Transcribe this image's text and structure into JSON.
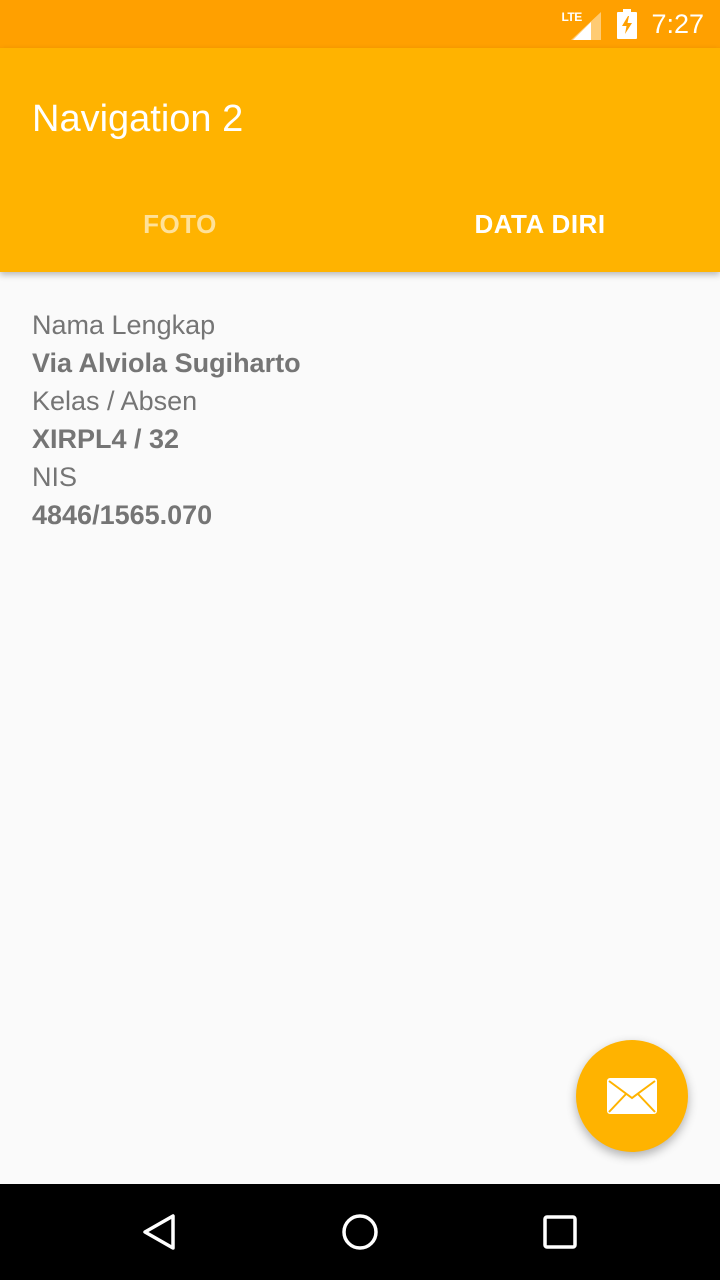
{
  "status_bar": {
    "network_label": "LTE",
    "time": "7:27",
    "icons": [
      "signal-icon",
      "battery-charging-icon"
    ]
  },
  "app_bar": {
    "title": "Navigation 2",
    "color": "#ffb300",
    "status_color": "#ffa000"
  },
  "tabs": [
    {
      "label": "FOTO",
      "selected": false
    },
    {
      "label": "DATA DIRI",
      "selected": true
    }
  ],
  "profile": {
    "name_label": "Nama Lengkap",
    "name_value": "Via Alviola Sugiharto",
    "class_label": "Kelas / Absen",
    "class_value": "XIRPL4 / 32",
    "nis_label": "NIS",
    "nis_value": "4846/1565.070"
  },
  "fab": {
    "icon": "mail-icon"
  },
  "nav_bar": {
    "icons": [
      "back-icon",
      "home-icon",
      "recents-icon"
    ]
  }
}
